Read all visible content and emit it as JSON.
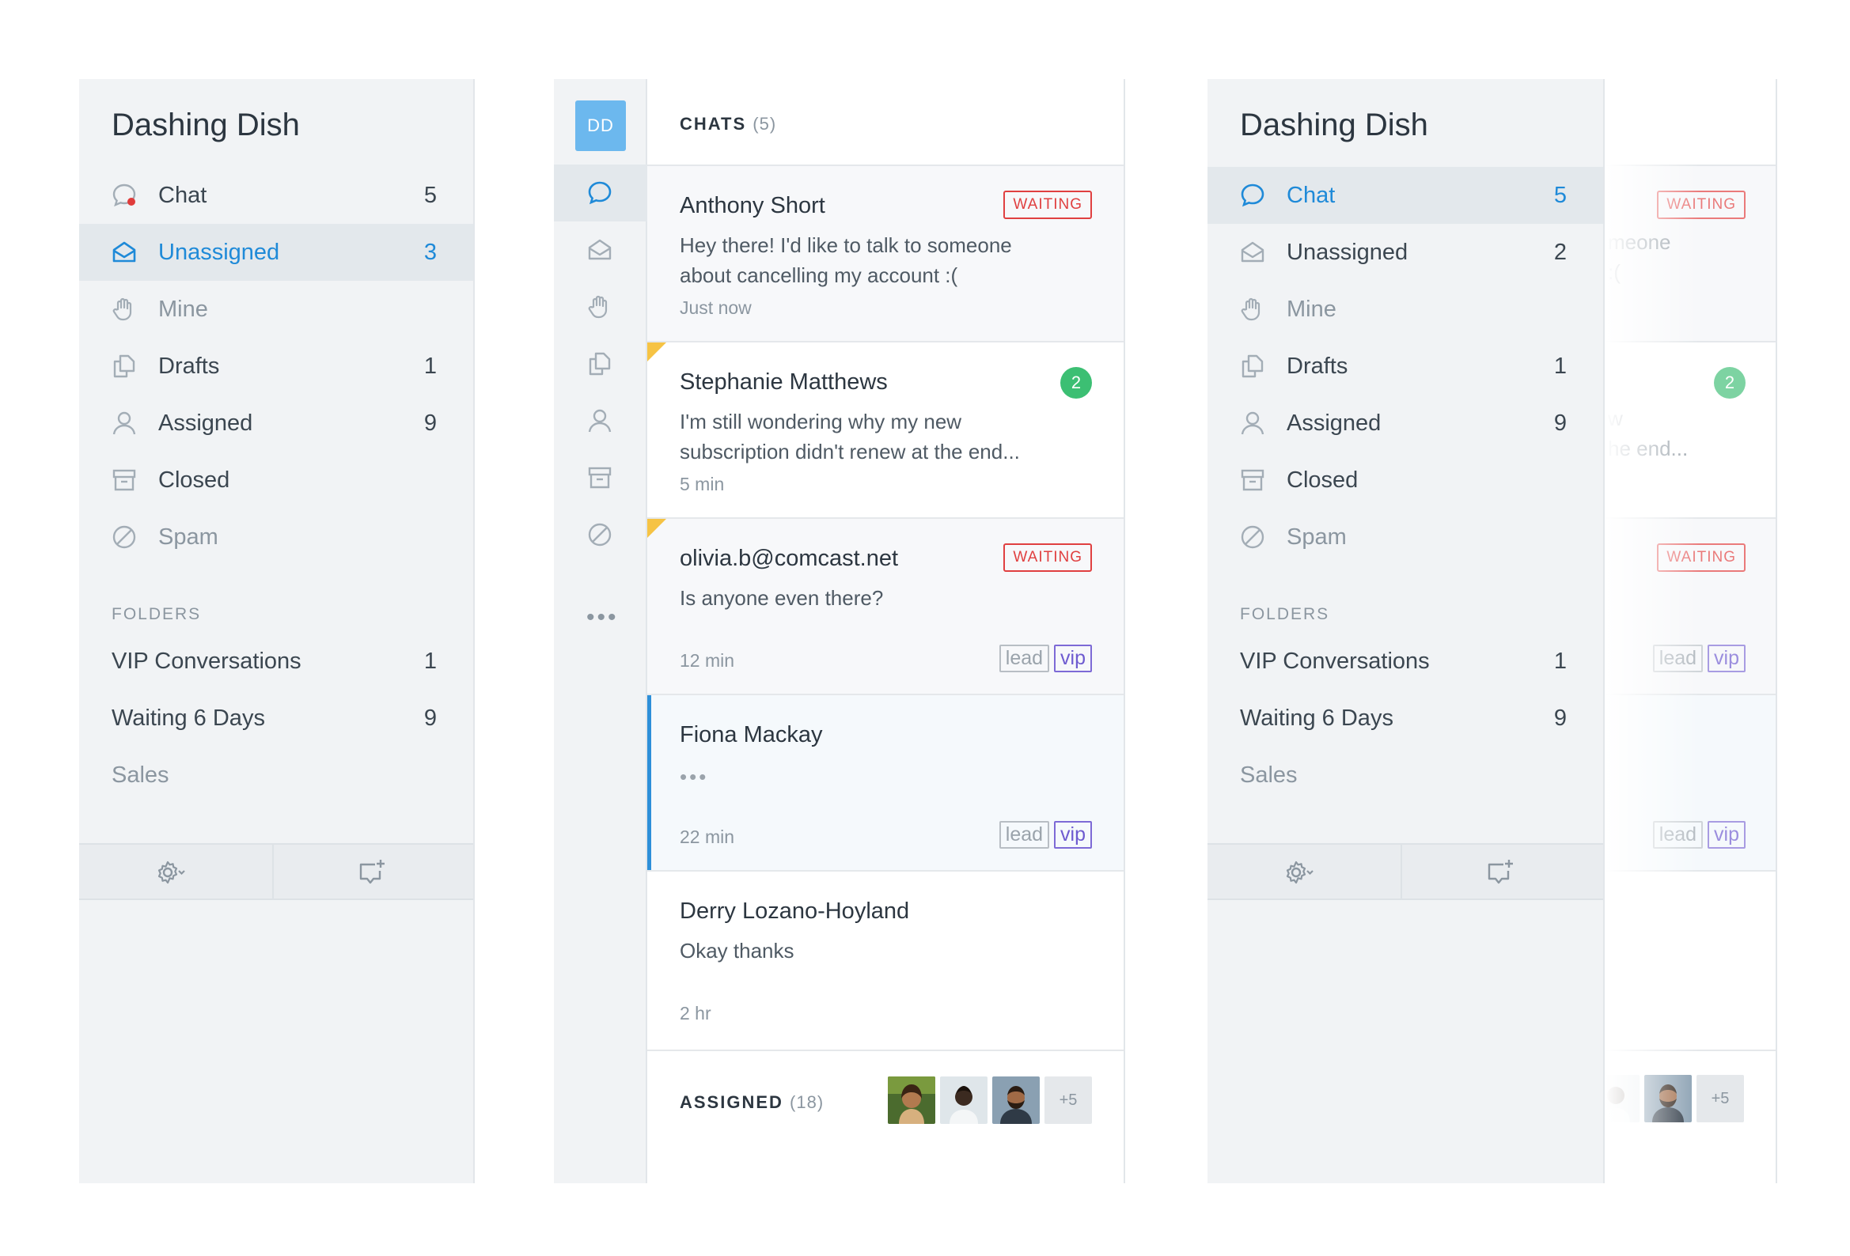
{
  "colors": {
    "accent": "#1f8ad8",
    "waiting": "#e04040",
    "unread": "#3cbf73",
    "vip": "#6e5bd0",
    "flag": "#f6c344"
  },
  "left_sidebar": {
    "brand": "Dashing Dish",
    "items": [
      {
        "icon": "chat-bubble-icon",
        "label": "Chat",
        "count": "5"
      },
      {
        "icon": "inbox-icon",
        "label": "Unassigned",
        "count": "3"
      },
      {
        "icon": "hand-icon",
        "label": "Mine",
        "count": ""
      },
      {
        "icon": "drafts-icon",
        "label": "Drafts",
        "count": "1"
      },
      {
        "icon": "person-icon",
        "label": "Assigned",
        "count": "9"
      },
      {
        "icon": "archive-icon",
        "label": "Closed",
        "count": ""
      },
      {
        "icon": "spam-icon",
        "label": "Spam",
        "count": ""
      }
    ],
    "folders_heading": "FOLDERS",
    "folders": [
      {
        "label": "VIP Conversations",
        "count": "1"
      },
      {
        "label": "Waiting 6 Days",
        "count": "9"
      },
      {
        "label": "Sales",
        "count": ""
      }
    ]
  },
  "rail": {
    "avatar_initials": "DD",
    "more": "•••"
  },
  "chats": {
    "heading": "CHATS",
    "count": "(5)",
    "items": [
      {
        "name": "Anthony Short",
        "preview": "Hey there! I'd like to talk to someone about cancelling my account :(",
        "time": "Just now",
        "status": "WAITING"
      },
      {
        "name": "Stephanie Matthews",
        "preview": "I'm still wondering why my new subscription didn't renew at the end...",
        "time": "5 min",
        "unread": "2"
      },
      {
        "name": "olivia.b@comcast.net",
        "preview": "Is anyone even there?",
        "time": "12 min",
        "status": "WAITING",
        "tags": [
          "lead",
          "vip"
        ]
      },
      {
        "name": "Fiona Mackay",
        "preview": "•••",
        "time": "22 min",
        "tags": [
          "lead",
          "vip"
        ]
      },
      {
        "name": "Derry Lozano-Hoyland",
        "preview": "Okay thanks",
        "time": "2 hr"
      }
    ]
  },
  "assigned": {
    "heading": "ASSIGNED",
    "count": "(18)",
    "more": "+5"
  },
  "right_sidebar": {
    "brand": "Dashing Dish",
    "items": [
      {
        "label": "Chat",
        "count": "5"
      },
      {
        "label": "Unassigned",
        "count": "2"
      },
      {
        "label": "Mine",
        "count": ""
      },
      {
        "label": "Drafts",
        "count": "1"
      },
      {
        "label": "Assigned",
        "count": "9"
      },
      {
        "label": "Closed",
        "count": ""
      },
      {
        "label": "Spam",
        "count": ""
      }
    ],
    "folders_heading": "FOLDERS",
    "folders": [
      {
        "label": "VIP Conversations",
        "count": "1"
      },
      {
        "label": "Waiting 6 Days",
        "count": "9"
      },
      {
        "label": "Sales",
        "count": ""
      }
    ]
  },
  "ghost": {
    "snippet_1": "meone",
    "snippet_2": ":(",
    "snippet_3": "w",
    "snippet_4": "he end...",
    "waiting": "WAITING",
    "unread": "2",
    "tag_lead": "lead",
    "tag_vip": "vip",
    "more": "+5"
  }
}
